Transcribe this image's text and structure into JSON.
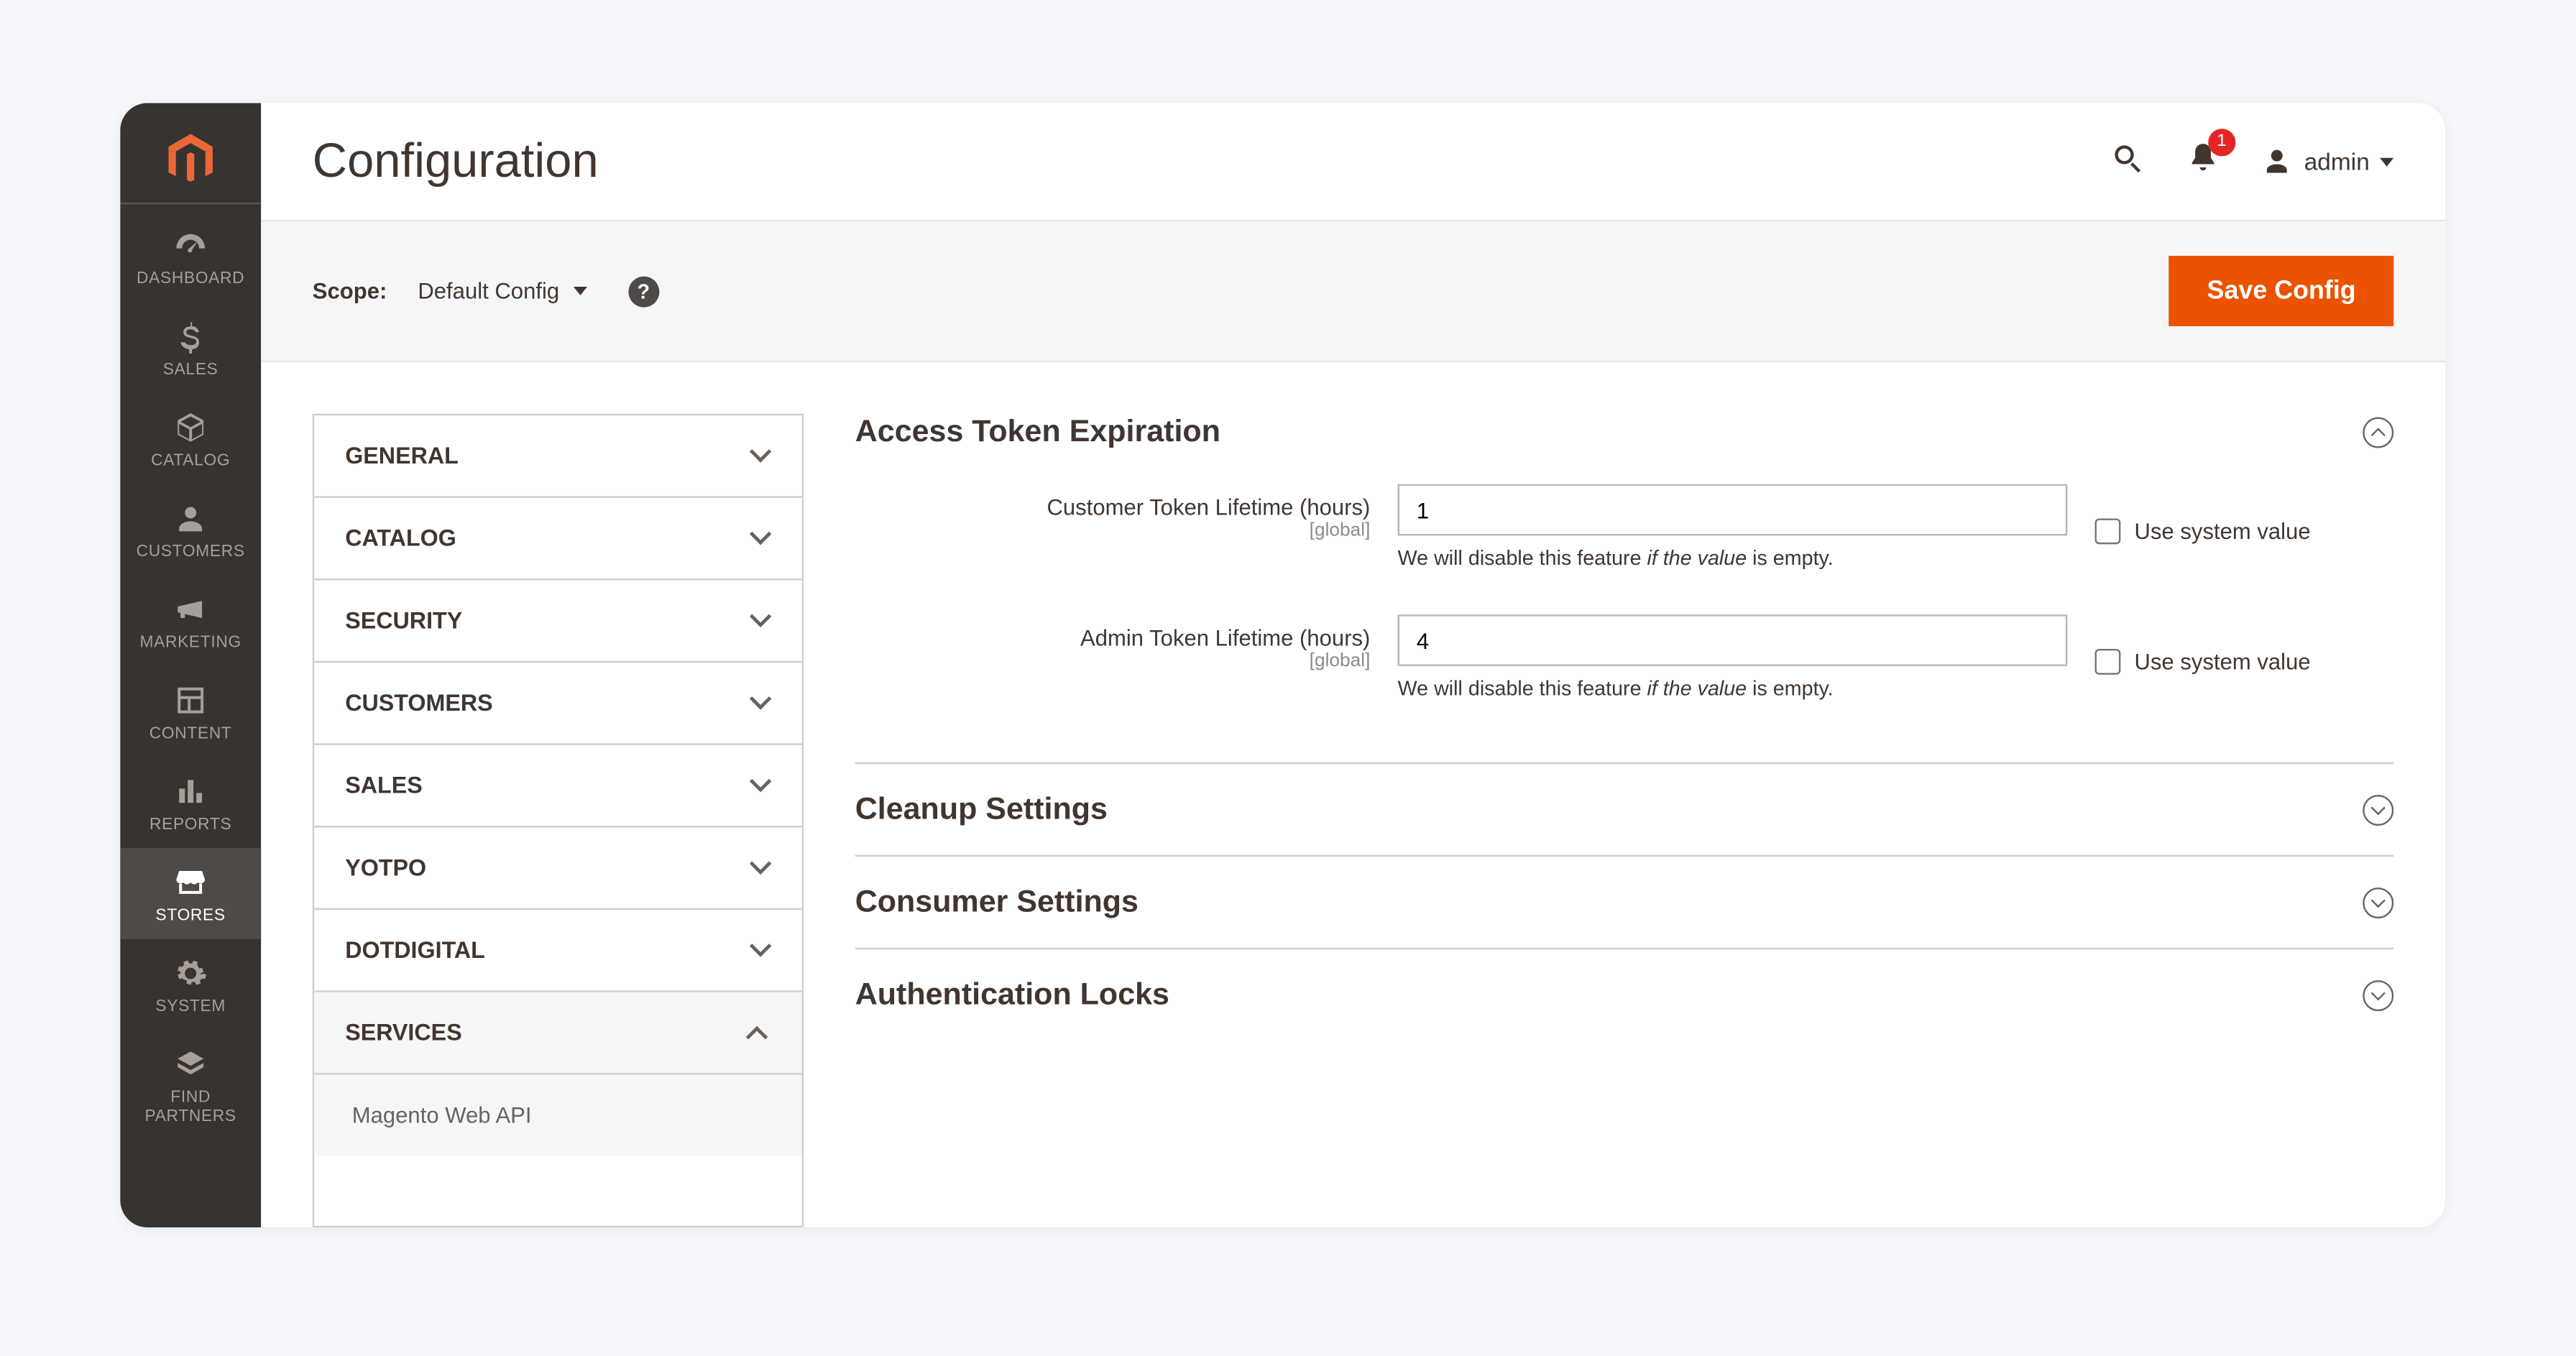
{
  "header": {
    "title": "Configuration",
    "notif_count": "1",
    "username": "admin"
  },
  "scopebar": {
    "scope_label": "Scope:",
    "scope_value": "Default Config",
    "save_label": "Save Config"
  },
  "sidebar": {
    "items": [
      {
        "label": "DASHBOARD"
      },
      {
        "label": "SALES"
      },
      {
        "label": "CATALOG"
      },
      {
        "label": "CUSTOMERS"
      },
      {
        "label": "MARKETING"
      },
      {
        "label": "CONTENT"
      },
      {
        "label": "REPORTS"
      },
      {
        "label": "STORES"
      },
      {
        "label": "SYSTEM"
      },
      {
        "label": "FIND PARTNERS"
      }
    ]
  },
  "config_tabs": [
    {
      "label": "GENERAL",
      "expanded": false
    },
    {
      "label": "CATALOG",
      "expanded": false
    },
    {
      "label": "SECURITY",
      "expanded": false
    },
    {
      "label": "CUSTOMERS",
      "expanded": false
    },
    {
      "label": "SALES",
      "expanded": false
    },
    {
      "label": "YOTPO",
      "expanded": false
    },
    {
      "label": "DOTDIGITAL",
      "expanded": false
    },
    {
      "label": "SERVICES",
      "expanded": true,
      "children": [
        {
          "label": "Magento Web API"
        }
      ]
    }
  ],
  "settings": {
    "section1_title": "Access Token Expiration",
    "field1": {
      "label": "Customer Token Lifetime (hours)",
      "scope": "[global]",
      "value": "1",
      "note_pre": "We will disable this feature ",
      "note_em": "if the value",
      "note_post": " is empty.",
      "check_label": "Use system value"
    },
    "field2": {
      "label": "Admin Token Lifetime (hours)",
      "scope": "[global]",
      "value": "4",
      "note_pre": "We will disable this feature ",
      "note_em": "if the value",
      "note_post": " is empty.",
      "check_label": "Use system value"
    },
    "section2_title": "Cleanup Settings",
    "section3_title": "Consumer Settings",
    "section4_title": "Authentication Locks"
  }
}
